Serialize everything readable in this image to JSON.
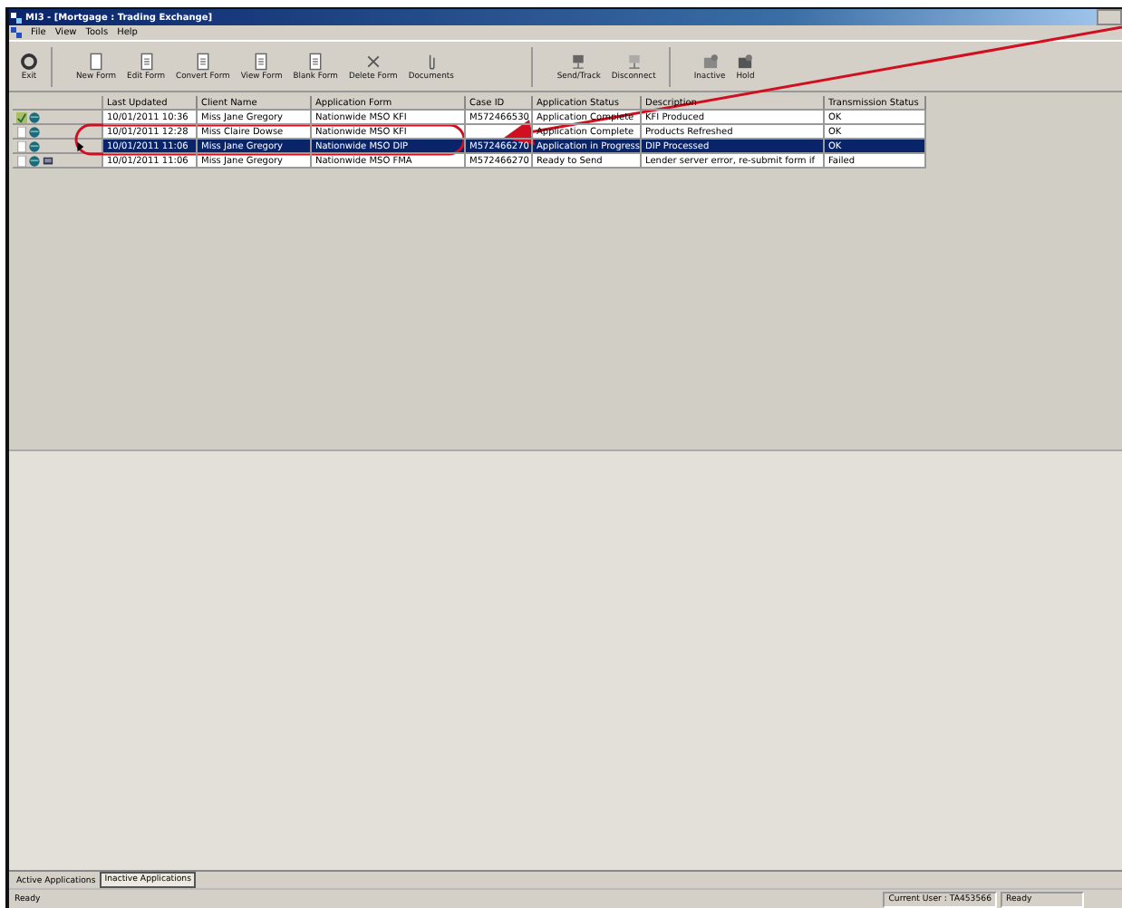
{
  "window": {
    "title": "MI3 - [Mortgage : Trading Exchange]"
  },
  "menu": [
    "File",
    "View",
    "Tools",
    "Help"
  ],
  "toolbar": [
    {
      "label": "Exit",
      "kind": "exit"
    },
    {
      "label": "New Form",
      "kind": "page"
    },
    {
      "label": "Edit Form",
      "kind": "edit"
    },
    {
      "label": "Convert Form",
      "kind": "convert"
    },
    {
      "label": "View Form",
      "kind": "view"
    },
    {
      "label": "Blank Form",
      "kind": "blank"
    },
    {
      "label": "Delete Form",
      "kind": "delete"
    },
    {
      "label": "Documents",
      "kind": "docs"
    },
    {
      "label": "Send/Track",
      "kind": "send"
    },
    {
      "label": "Disconnect",
      "kind": "disconnect"
    },
    {
      "label": "Inactive",
      "kind": "inactive"
    },
    {
      "label": "Hold",
      "kind": "hold"
    }
  ],
  "table": {
    "columns": [
      "Last Updated",
      "Client Name",
      "Application Form",
      "Case ID",
      "Application Status",
      "Description",
      "Transmission Status"
    ],
    "rows": [
      {
        "selected": false,
        "kind": "ticked",
        "monitor": false,
        "cells": [
          "10/01/2011 10:36",
          "Miss Jane Gregory",
          "Nationwide MSO KFI",
          "M572466530",
          "Application Complete",
          "KFI Produced",
          "OK"
        ]
      },
      {
        "selected": false,
        "kind": "plain",
        "monitor": false,
        "cells": [
          "10/01/2011 12:28",
          "Miss Claire Dowse",
          "Nationwide MSO KFI",
          null,
          "Application Complete",
          "Products Refreshed",
          "OK"
        ]
      },
      {
        "selected": true,
        "kind": "plain",
        "monitor": false,
        "cells": [
          "10/01/2011 11:06",
          "Miss Jane Gregory",
          "Nationwide MSO DIP",
          "M572466270",
          "Application in Progress",
          "DIP Processed",
          "OK"
        ]
      },
      {
        "selected": false,
        "kind": "plain",
        "monitor": true,
        "cells": [
          "10/01/2011 11:06",
          "Miss Jane Gregory",
          "Nationwide MSO FMA",
          "M572466270",
          "Ready to Send",
          "Lender server error, re-submit form if",
          "Failed"
        ]
      }
    ]
  },
  "tabs": [
    {
      "label": "Active Applications",
      "selected": false
    },
    {
      "label": "Inactive Applications",
      "selected": true
    }
  ],
  "status_bar": {
    "message": "Ready",
    "user": "Current User : TA453566",
    "state": "Ready"
  }
}
